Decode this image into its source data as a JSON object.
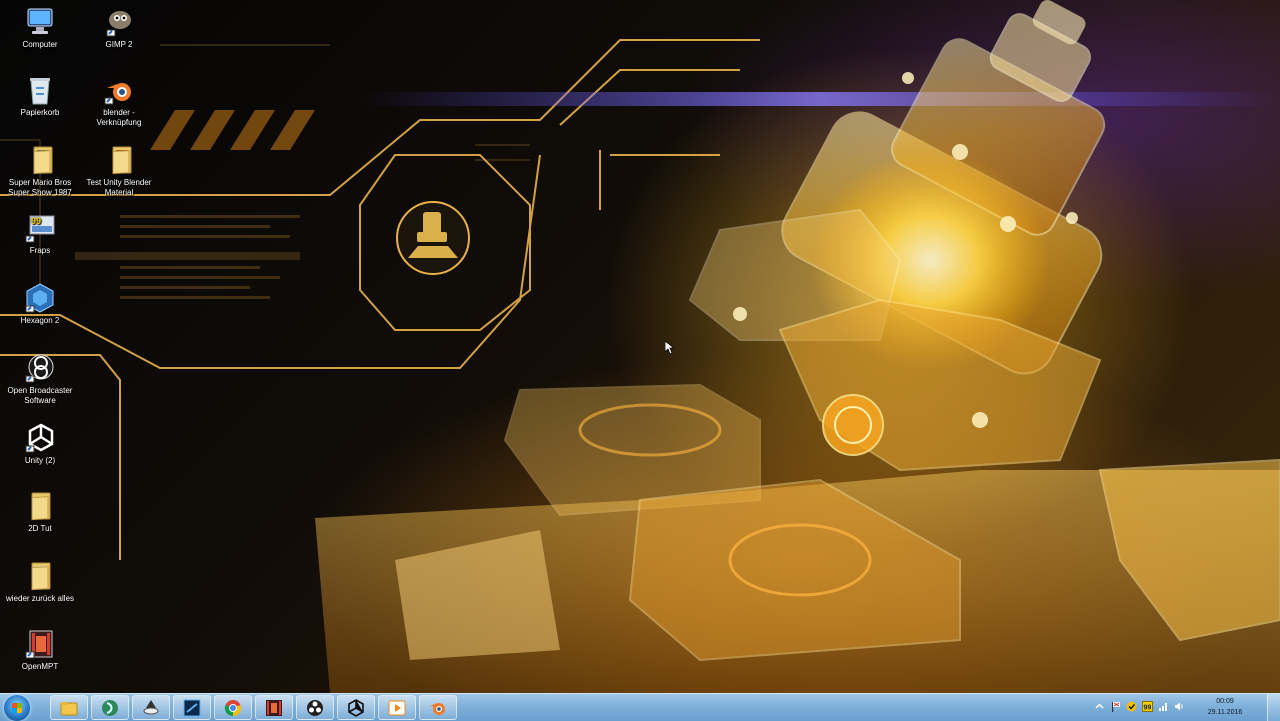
{
  "desktop": {
    "icons": [
      {
        "label": "Computer",
        "icon": "computer-icon"
      },
      {
        "label": "GIMP 2",
        "icon": "gimp-icon"
      },
      {
        "label": "Papierkorb",
        "icon": "recycle-bin-icon"
      },
      {
        "label": "blender - Verknüpfung",
        "icon": "blender-icon"
      },
      {
        "label": "Super Mario Bros Super Show 1987",
        "icon": "folder-icon"
      },
      {
        "label": "Test Unity Blender Material",
        "icon": "folder-icon"
      },
      {
        "label": "Fraps",
        "icon": "fraps-icon"
      },
      {
        "label": "Hexagon 2",
        "icon": "hexagon-icon"
      },
      {
        "label": "Open Broadcaster Software",
        "icon": "obs-icon"
      },
      {
        "label": "Unity (2)",
        "icon": "unity-icon"
      },
      {
        "label": "2D Tut",
        "icon": "folder-icon"
      },
      {
        "label": "wieder zurück alles",
        "icon": "folder-icon"
      },
      {
        "label": "OpenMPT",
        "icon": "openmpt-icon"
      }
    ]
  },
  "wallpaper": {
    "accent_color": "#f0b030",
    "glow_color": "#6a4cff",
    "description_icon": "microscope-icon"
  },
  "taskbar": {
    "start_icon": "windows-start-icon",
    "pinned": [
      {
        "name": "explorer",
        "icon": "folder-icon"
      },
      {
        "name": "media-player",
        "icon": "media-player-icon"
      },
      {
        "name": "inkscape",
        "icon": "inkscape-icon"
      },
      {
        "name": "photoshop",
        "icon": "photoshop-icon"
      },
      {
        "name": "chrome",
        "icon": "chrome-icon"
      },
      {
        "name": "openmpt",
        "icon": "film-icon"
      },
      {
        "name": "obs",
        "icon": "obs-icon"
      },
      {
        "name": "unity",
        "icon": "unity-icon"
      },
      {
        "name": "player",
        "icon": "play-icon"
      },
      {
        "name": "blender",
        "icon": "blender-icon"
      }
    ],
    "tray_icons": [
      "chevron-up-icon",
      "flag-icon",
      "norton-icon",
      "fraps-tray-icon",
      "network-icon",
      "volume-icon"
    ],
    "clock": {
      "time": "00:09",
      "date": "29.11.2016"
    }
  }
}
